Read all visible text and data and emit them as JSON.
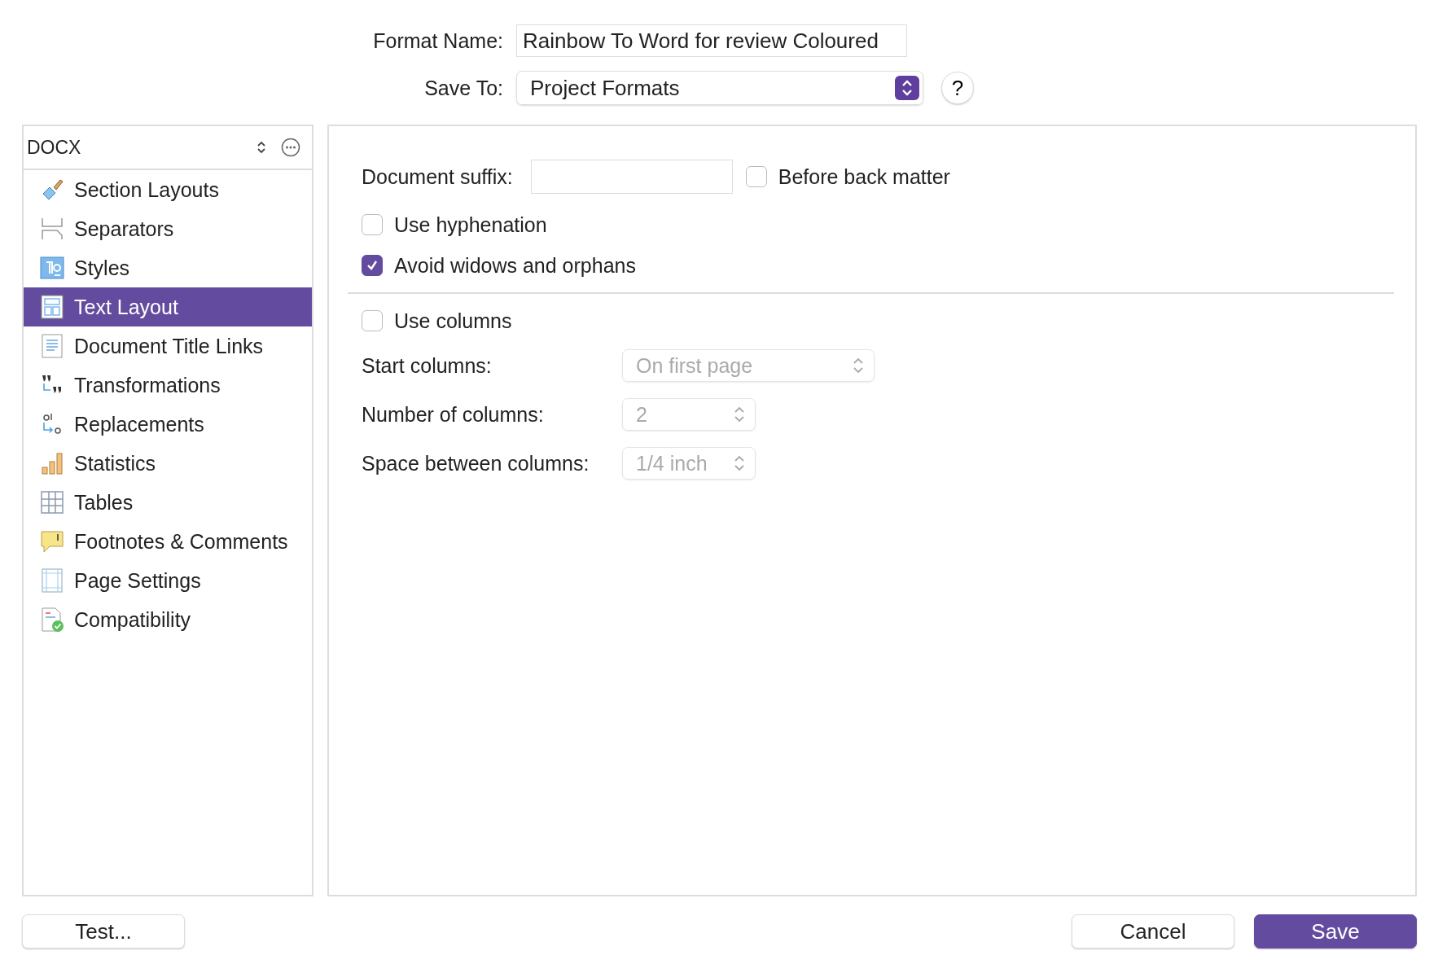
{
  "header": {
    "format_name_label": "Format Name:",
    "format_name": "Rainbow To Word for review Coloured",
    "save_to_label": "Save To:",
    "save_to": "Project Formats",
    "help": "?"
  },
  "sidebar": {
    "title": "DOCX",
    "items": [
      {
        "label": "Section Layouts",
        "selected": false
      },
      {
        "label": "Separators",
        "selected": false
      },
      {
        "label": "Styles",
        "selected": false
      },
      {
        "label": "Text Layout",
        "selected": true
      },
      {
        "label": "Document Title Links",
        "selected": false
      },
      {
        "label": "Transformations",
        "selected": false
      },
      {
        "label": "Replacements",
        "selected": false
      },
      {
        "label": "Statistics",
        "selected": false
      },
      {
        "label": "Tables",
        "selected": false
      },
      {
        "label": "Footnotes & Comments",
        "selected": false
      },
      {
        "label": "Page Settings",
        "selected": false
      },
      {
        "label": "Compatibility",
        "selected": false
      }
    ]
  },
  "panel": {
    "suffix_label": "Document suffix:",
    "before_back_matter": {
      "label": "Before back matter",
      "checked": false
    },
    "options": [
      {
        "label": "Use hyphenation",
        "checked": false
      },
      {
        "label": "Avoid widows and orphans",
        "checked": true
      }
    ],
    "use_columns": {
      "label": "Use columns",
      "checked": false
    },
    "column_settings": [
      {
        "label": "Start columns:",
        "value": "On first page",
        "kind": "popup",
        "disabled": true
      },
      {
        "label": "Number of columns:",
        "value": "2",
        "kind": "stepper",
        "disabled": true
      },
      {
        "label": "Space between columns:",
        "value": "1/4 inch",
        "kind": "stepper",
        "disabled": true
      }
    ]
  },
  "buttons": {
    "test": "Test...",
    "cancel": "Cancel",
    "save": "Save"
  }
}
